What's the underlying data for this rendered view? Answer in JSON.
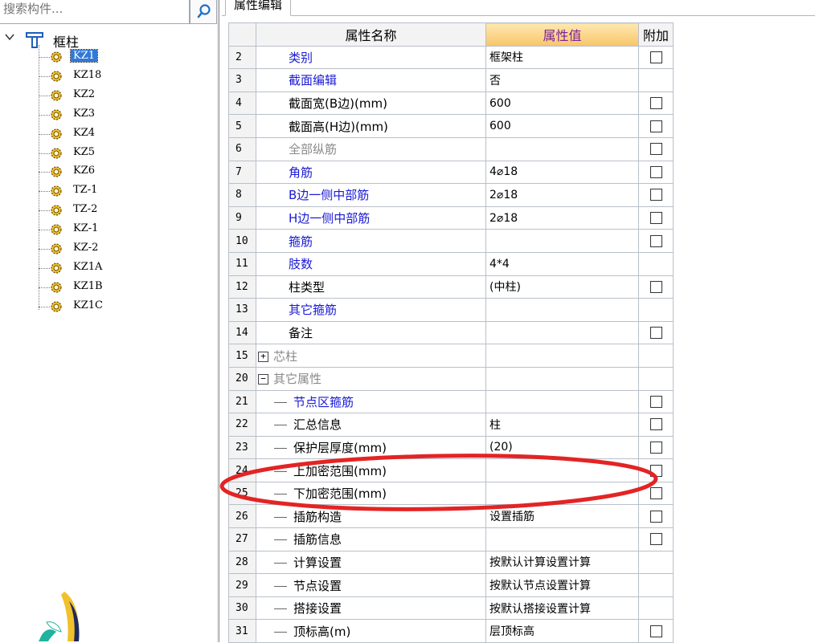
{
  "search": {
    "placeholder": "搜索构件..."
  },
  "tab": {
    "label": "属性编辑"
  },
  "tree": {
    "root_label": "框柱",
    "items": [
      "KZ1",
      "KZ18",
      "KZ2",
      "KZ3",
      "KZ4",
      "KZ5",
      "KZ6",
      "TZ-1",
      "TZ-2",
      "KZ-1",
      "KZ-2",
      "KZ1A",
      "KZ1B",
      "KZ1C"
    ],
    "selected": "KZ1"
  },
  "grid": {
    "headers": {
      "name": "属性名称",
      "value": "属性值",
      "add": "附加"
    },
    "rows": [
      {
        "num": "2",
        "name": "类别",
        "value": "框架柱",
        "style": "blue",
        "checkbox": true
      },
      {
        "num": "3",
        "name": "截面编辑",
        "value": "否",
        "style": "blue",
        "checkbox": false
      },
      {
        "num": "4",
        "name": "截面宽(B边)(mm)",
        "value": "600",
        "style": "black",
        "checkbox": true
      },
      {
        "num": "5",
        "name": "截面高(H边)(mm)",
        "value": "600",
        "style": "black",
        "checkbox": true
      },
      {
        "num": "6",
        "name": "全部纵筋",
        "value": "",
        "style": "gray",
        "checkbox": true
      },
      {
        "num": "7",
        "name": "角筋",
        "value": "4⌀18",
        "style": "blue",
        "checkbox": true
      },
      {
        "num": "8",
        "name": "B边一侧中部筋",
        "value": "2⌀18",
        "style": "blue",
        "checkbox": true
      },
      {
        "num": "9",
        "name": "H边一侧中部筋",
        "value": "2⌀18",
        "style": "blue",
        "checkbox": true
      },
      {
        "num": "10",
        "name": "箍筋",
        "value": "",
        "style": "blue",
        "checkbox": true
      },
      {
        "num": "11",
        "name": "肢数",
        "value": "4*4",
        "style": "blue",
        "checkbox": false
      },
      {
        "num": "12",
        "name": "柱类型",
        "value": "(中柱)",
        "style": "black",
        "checkbox": true
      },
      {
        "num": "13",
        "name": "其它箍筋",
        "value": "",
        "style": "blue",
        "checkbox": false
      },
      {
        "num": "14",
        "name": "备注",
        "value": "",
        "style": "black",
        "checkbox": true
      },
      {
        "num": "15",
        "name": "芯柱",
        "value": "",
        "style": "gray",
        "checkbox": false,
        "expander": "+"
      },
      {
        "num": "20",
        "name": "其它属性",
        "value": "",
        "style": "gray",
        "checkbox": false,
        "expander": "−"
      },
      {
        "num": "21",
        "name": "节点区箍筋",
        "value": "",
        "style": "blue",
        "checkbox": true,
        "child": true
      },
      {
        "num": "22",
        "name": "汇总信息",
        "value": "柱",
        "style": "black",
        "checkbox": true,
        "child": true
      },
      {
        "num": "23",
        "name": "保护层厚度(mm)",
        "value": "(20)",
        "style": "black",
        "checkbox": true,
        "child": true
      },
      {
        "num": "24",
        "name": "上加密范围(mm)",
        "value": "",
        "style": "black",
        "checkbox": true,
        "child": true
      },
      {
        "num": "25",
        "name": "下加密范围(mm)",
        "value": "",
        "style": "black",
        "checkbox": true,
        "child": true
      },
      {
        "num": "26",
        "name": "插筋构造",
        "value": "设置插筋",
        "style": "black",
        "checkbox": true,
        "child": true
      },
      {
        "num": "27",
        "name": "插筋信息",
        "value": "",
        "style": "black",
        "checkbox": true,
        "child": true
      },
      {
        "num": "28",
        "name": "计算设置",
        "value": "按默认计算设置计算",
        "style": "black",
        "checkbox": false,
        "child": true
      },
      {
        "num": "29",
        "name": "节点设置",
        "value": "按默认节点设置计算",
        "style": "black",
        "checkbox": false,
        "child": true
      },
      {
        "num": "30",
        "name": "搭接设置",
        "value": "按默认搭接设置计算",
        "style": "black",
        "checkbox": false,
        "child": true
      },
      {
        "num": "31",
        "name": "顶标高(m)",
        "value": "层顶标高",
        "style": "black",
        "checkbox": true,
        "child": true
      }
    ]
  },
  "colors": {
    "selection": "#3179d6",
    "name_blue": "#1a1ad6",
    "annotation_red": "#e32424",
    "value_header": "#f7c56a"
  },
  "icons": {
    "search": "search-icon",
    "root": "funnel-icon",
    "item": "gear-icon",
    "collapse": "chevron-down-icon"
  }
}
